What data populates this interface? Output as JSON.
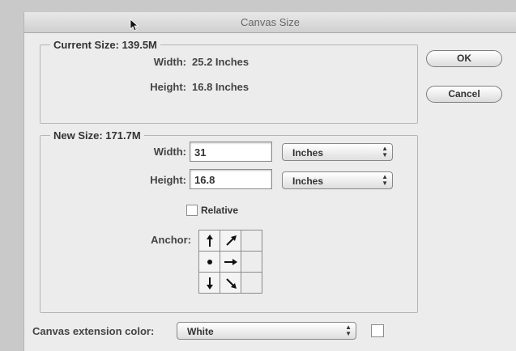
{
  "window": {
    "title": "Canvas Size"
  },
  "current_size": {
    "legend": "Current Size: 139.5M",
    "width_label": "Width:",
    "width_value": "25.2 Inches",
    "height_label": "Height:",
    "height_value": "16.8 Inches"
  },
  "buttons": {
    "ok": "OK",
    "cancel": "Cancel"
  },
  "new_size": {
    "legend": "New Size: 171.7M",
    "width_label": "Width:",
    "width_value": "31",
    "width_unit": "Inches",
    "height_label": "Height:",
    "height_value": "16.8",
    "height_unit": "Inches",
    "relative_label": "Relative",
    "relative_checked": false,
    "anchor_label": "Anchor:"
  },
  "extension": {
    "label": "Canvas extension color:",
    "value": "White",
    "swatch_color": "#ffffff"
  }
}
